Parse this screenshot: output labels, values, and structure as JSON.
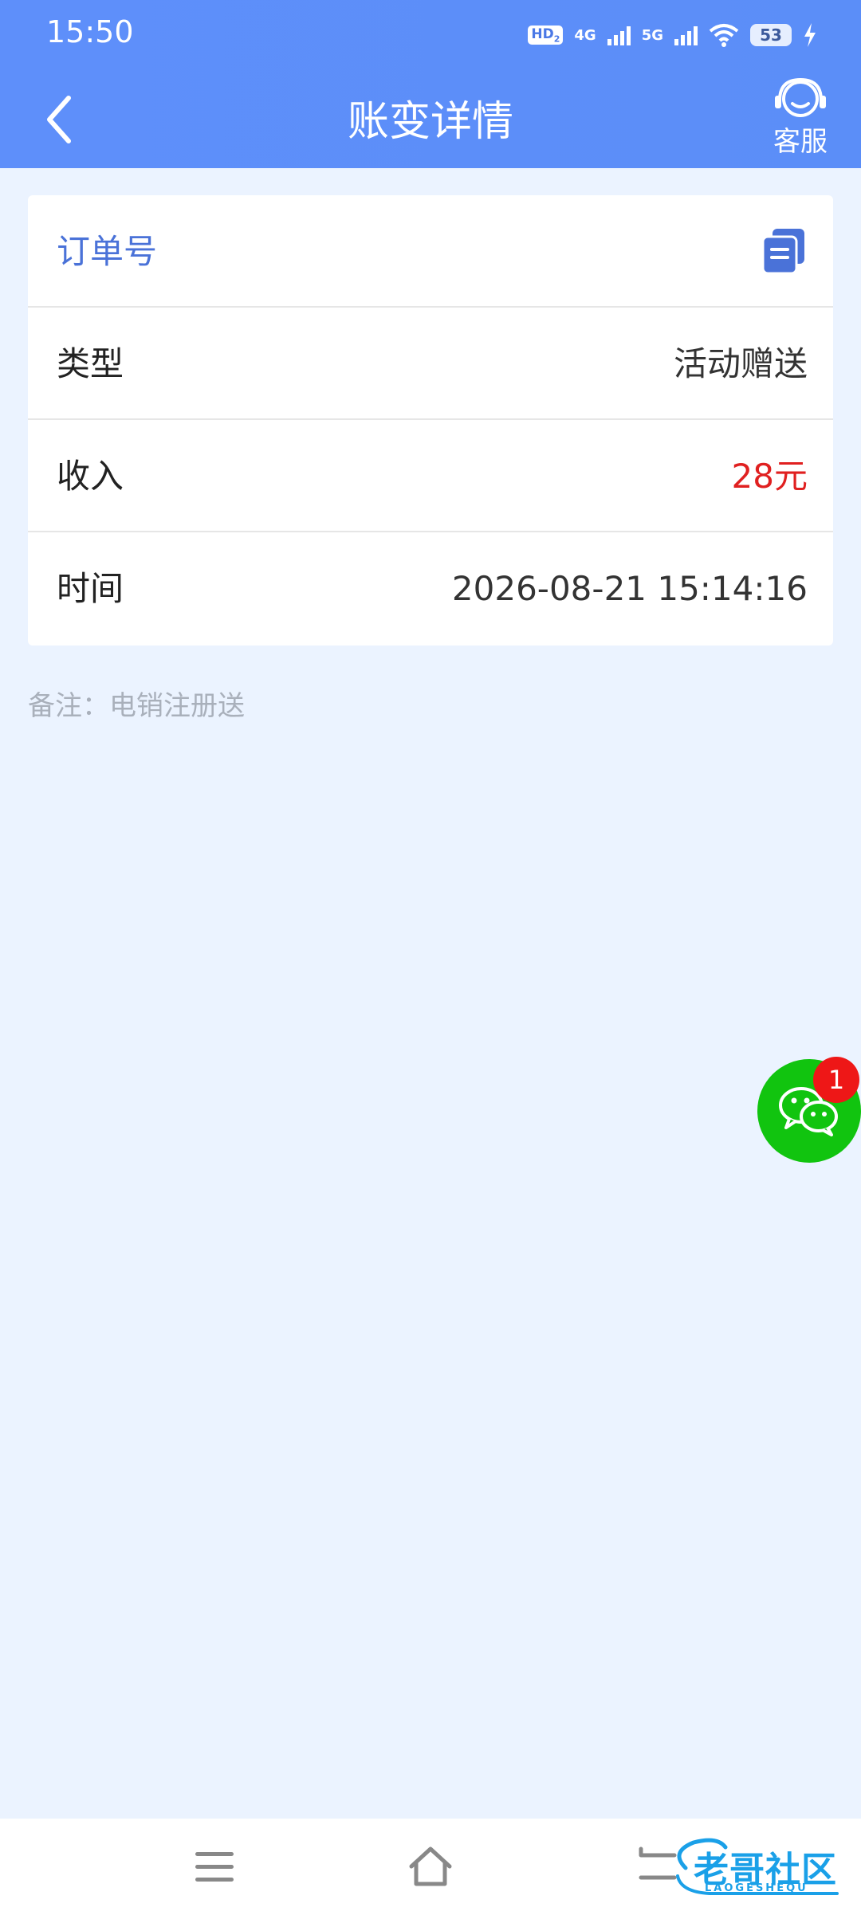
{
  "status_bar": {
    "time": "15:50",
    "hd_label": "HD",
    "hd_sub": "2",
    "network_1": "4G",
    "network_2": "5G",
    "battery_level": "53"
  },
  "header": {
    "title": "账变详情",
    "service_label": "客服"
  },
  "detail_rows": [
    {
      "label": "订单号",
      "value": ""
    },
    {
      "label": "类型",
      "value": "活动赠送"
    },
    {
      "label": "收入",
      "value": "28元"
    },
    {
      "label": "时间",
      "value": "2026-08-21 15:14:16"
    }
  ],
  "remark": "备注：电销注册送",
  "chat_fab": {
    "badge_count": "1"
  },
  "watermark": {
    "text": "老哥社区",
    "sub": "LAOGESHEQU"
  },
  "colors": {
    "header": "#5b8ef8",
    "order_label": "#4a72d8",
    "income": "#e02020",
    "chat_fab": "#11c40f",
    "badge": "#ee1717"
  },
  "icons": {
    "back": "chevron-left-icon",
    "service": "headset-icon",
    "copy": "copy-icon",
    "chat": "wechat-icon"
  }
}
